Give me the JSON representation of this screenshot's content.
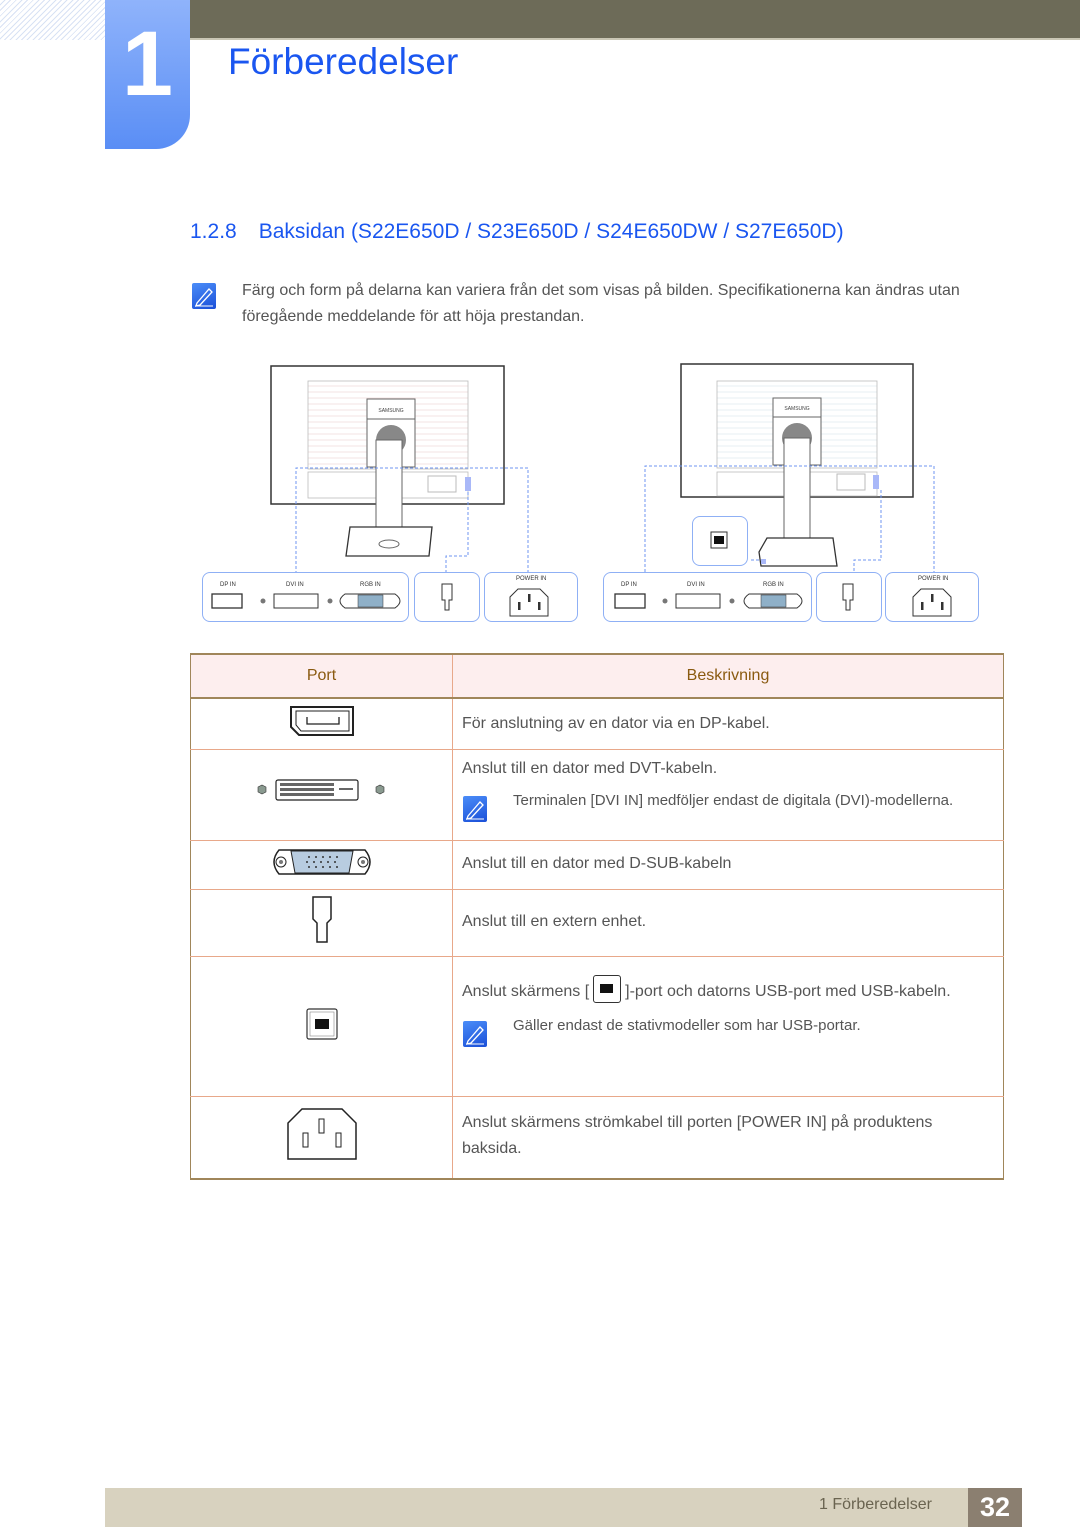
{
  "chapter": {
    "number": "1",
    "title": "Förberedelser"
  },
  "section": {
    "number": "1.2.8",
    "title": "Baksidan (S22E650D / S23E650D / S24E650DW / S27E650D)"
  },
  "intro_note": {
    "icon": "note-pencil-icon",
    "text": "Färg och form på delarna kan variera från det som visas på bilden. Specifikationerna kan ändras utan föregående meddelande för att höja prestandan."
  },
  "diagrams": [
    {
      "name": "monitor-without-usb",
      "brand": "SAMSUNG",
      "port_labels": [
        "DP IN",
        "DVI IN",
        "RGB IN",
        "POWER IN"
      ]
    },
    {
      "name": "monitor-with-usb",
      "brand": "SAMSUNG",
      "port_labels": [
        "DP IN",
        "DVI IN",
        "RGB IN",
        "POWER IN"
      ]
    }
  ],
  "table": {
    "headers": [
      "Port",
      "Beskrivning"
    ],
    "rows": [
      {
        "port_icon": "displayport-icon",
        "description": "För anslutning av en dator via en DP-kabel."
      },
      {
        "port_icon": "dvi-port-icon",
        "description": "Anslut till en dator med DVT-kabeln.",
        "note": "Terminalen [DVI IN] medföljer endast de digitala (DVI)-modellerna."
      },
      {
        "port_icon": "vga-port-icon",
        "description": "Anslut till en dator med D-SUB-kabeln"
      },
      {
        "port_icon": "service-port-icon",
        "description": "Anslut till en extern enhet."
      },
      {
        "port_icon": "usb-b-port-icon",
        "description_before": "Anslut skärmens [",
        "description_after": "]-port och datorns USB-port med USB-kabeln.",
        "note": "Gäller endast de stativmodeller som har USB-portar."
      },
      {
        "port_icon": "power-in-icon",
        "description": "Anslut skärmens strömkabel till porten [POWER IN] på produktens baksida."
      }
    ]
  },
  "footer": {
    "label": "1 Förberedelser",
    "page": "32"
  },
  "colors": {
    "accent_blue": "#1a56f0",
    "header_band": "#6d6b58",
    "footer_band": "#d8d2bf",
    "page_badge": "#8b7f70",
    "table_header_bg": "#fdeeee",
    "table_header_text": "#8a5a10"
  }
}
